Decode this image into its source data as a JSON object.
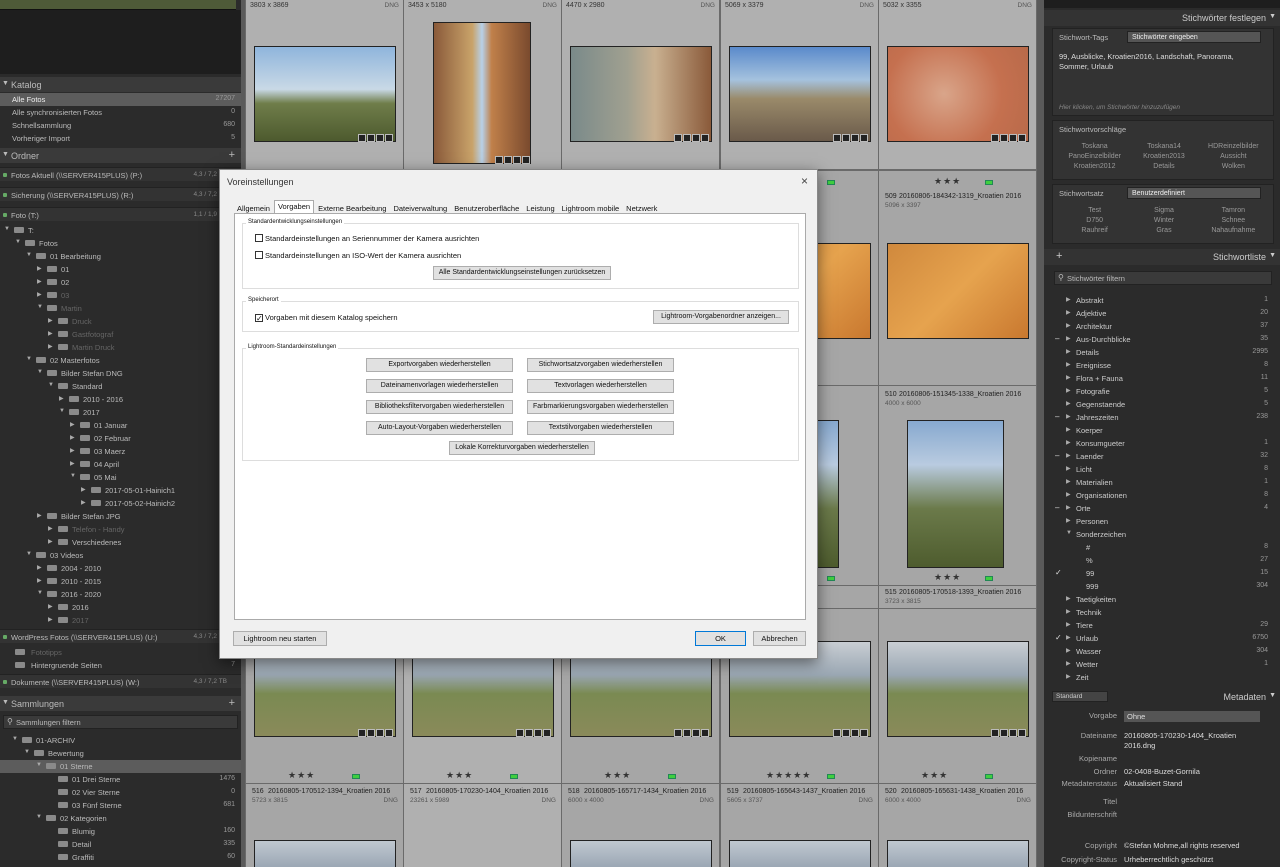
{
  "left": {
    "catalog": {
      "header": "Katalog",
      "items": [
        {
          "label": "Alle Fotos",
          "count": "27207",
          "selected": true
        },
        {
          "label": "Alle synchronisierten Fotos",
          "count": "0"
        },
        {
          "label": "Schnellsammlung",
          "count": "680"
        },
        {
          "label": "Vorheriger Import",
          "count": "5"
        }
      ]
    },
    "folders": {
      "header": "Ordner",
      "volumes": [
        {
          "label": "Fotos Aktuell (\\\\SERVER415PLUS) (P:)",
          "size": "4,3 / 7,2 TB"
        },
        {
          "label": "Sicherung (\\\\SERVER415PLUS) (R:)",
          "size": "4,3 / 7,2 TB"
        },
        {
          "label": "Foto (T:)",
          "size": "1,1 / 1,9 TB"
        }
      ],
      "tree": [
        {
          "d": 0,
          "label": "T:",
          "open": true,
          "count": "2"
        },
        {
          "d": 1,
          "label": "Fotos",
          "open": true,
          "count": "2"
        },
        {
          "d": 2,
          "label": "01 Bearbeitung",
          "open": true,
          "count": "2"
        },
        {
          "d": 3,
          "label": "01"
        },
        {
          "d": 3,
          "label": "02"
        },
        {
          "d": 3,
          "label": "03",
          "dim": true
        },
        {
          "d": 3,
          "label": "Martin",
          "open": true,
          "dim": true
        },
        {
          "d": 4,
          "label": "Druck",
          "dim": true
        },
        {
          "d": 4,
          "label": "Gastfotograf",
          "dim": true
        },
        {
          "d": 4,
          "label": "Martin Druck",
          "dim": true
        },
        {
          "d": 2,
          "label": "02 Masterfotos",
          "open": true,
          "count": "2"
        },
        {
          "d": 3,
          "label": "Bilder Stefan DNG",
          "open": true,
          "count": "2"
        },
        {
          "d": 4,
          "label": "Standard",
          "open": true,
          "count": "2"
        },
        {
          "d": 5,
          "label": "2010 - 2016",
          "count": "2"
        },
        {
          "d": 5,
          "label": "2017",
          "open": true
        },
        {
          "d": 6,
          "label": "01 Januar"
        },
        {
          "d": 6,
          "label": "02 Februar"
        },
        {
          "d": 6,
          "label": "03 Maerz"
        },
        {
          "d": 6,
          "label": "04 April"
        },
        {
          "d": 6,
          "label": "05 Mai",
          "open": true
        },
        {
          "d": 7,
          "label": "2017-05-01-Hainich1"
        },
        {
          "d": 7,
          "label": "2017-05-02-Hainich2"
        },
        {
          "d": 3,
          "label": "Bilder Stefan JPG",
          "count": "2"
        },
        {
          "d": 4,
          "label": "Telefon - Handy",
          "dim": true
        },
        {
          "d": 4,
          "label": "Verschiedenes"
        },
        {
          "d": 2,
          "label": "03 Videos",
          "open": true,
          "count": "2"
        },
        {
          "d": 3,
          "label": "2004 - 2010",
          "count": "2"
        },
        {
          "d": 3,
          "label": "2010 - 2015",
          "count": "2"
        },
        {
          "d": 3,
          "label": "2016 - 2020",
          "open": true,
          "count": "2"
        },
        {
          "d": 4,
          "label": "2016",
          "count": "2"
        },
        {
          "d": 4,
          "label": "2017",
          "dim": true
        }
      ],
      "volume4": {
        "label": "WordPress Fotos (\\\\SERVER415PLUS) (U:)",
        "size": "4,3 / 7,2 TB"
      },
      "extra": [
        {
          "label": "Fototipps",
          "dim": true
        },
        {
          "label": "Hintergruende Seiten",
          "count": "7"
        }
      ],
      "volume5": {
        "label": "Dokumente (\\\\SERVER415PLUS) (W:)",
        "size": "4,3 / 7,2 TB"
      }
    },
    "collections": {
      "header": "Sammlungen",
      "filter": "Sammlungen filtern",
      "tree": [
        {
          "d": 0,
          "label": "01-ARCHIV"
        },
        {
          "d": 1,
          "label": "Bewertung"
        },
        {
          "d": 2,
          "label": "01 Sterne",
          "selected": true
        },
        {
          "d": 3,
          "label": "01 Drei Sterne",
          "count": "1476"
        },
        {
          "d": 3,
          "label": "02 Vier Sterne",
          "count": "0"
        },
        {
          "d": 3,
          "label": "03 Fünf Sterne",
          "count": "681"
        },
        {
          "d": 2,
          "label": "02 Kategorien"
        },
        {
          "d": 3,
          "label": "Blumig",
          "count": "160"
        },
        {
          "d": 3,
          "label": "Detail",
          "count": "335"
        },
        {
          "d": 3,
          "label": "Graffiti",
          "count": "60"
        }
      ]
    }
  },
  "grid": {
    "row0": [
      {
        "dims": "3803 x 3869",
        "ext": "DNG"
      },
      {
        "dims": "3453 x 5180",
        "ext": "DNG"
      },
      {
        "dims": "4470 x 2980",
        "ext": "DNG"
      },
      {
        "dims": "5069 x 3379",
        "ext": "DNG"
      },
      {
        "dims": "5032 x 3355",
        "ext": "DNG"
      }
    ],
    "row1_right": [
      {
        "name": "8_Kroatien 2016",
        "dims": "5096 x 3397"
      },
      {
        "num": "509",
        "name": "20160806-184342-1319_Kroatien 2016",
        "dims": "5096 x 3397"
      }
    ],
    "row2_right": [
      {
        "name": "7_Kroatien 2016",
        "dims": "4000 x 6000"
      },
      {
        "num": "510",
        "name": "20160806-151345-1338_Kroatien 2016",
        "dims": "4000 x 6000"
      }
    ],
    "row3_right": [
      {
        "name": "8_Kroatien 2016",
        "dims": "3723 x 3815"
      },
      {
        "num": "515",
        "name": "20160805-170518-1393_Kroatien 2016",
        "dims": "3723 x 3815"
      }
    ],
    "row4": [
      {
        "num": "516",
        "name": "20160805-170512-1394_Kroatien 2016",
        "dims": "5723 x 3815",
        "stars": "★★★"
      },
      {
        "num": "517",
        "name": "20160805-170230-1404_Kroatien 2016",
        "dims": "23261 x 5989",
        "stars": "★★★"
      },
      {
        "num": "518",
        "name": "20160805-165717-1434_Kroatien 2016",
        "dims": "6000 x 4000",
        "stars": "★★★"
      },
      {
        "num": "519",
        "name": "20160805-165643-1437_Kroatien 2016",
        "dims": "5605 x 3737",
        "stars": "★★★★★"
      },
      {
        "num": "520",
        "name": "20160805-165631-1438_Kroatien 2016",
        "dims": "6000 x 4000",
        "stars": "★★★"
      }
    ],
    "ext": "DNG",
    "stars3": "★★★"
  },
  "right": {
    "top_label": "Stichwörter festlegen",
    "kw_tags_label": "Stichwort-Tags",
    "kw_tags_select": "Stichwörter eingeben",
    "kw_text": "99, Ausblicke, Kroatien2016, Landschaft, Panorama, Sommer, Urlaub",
    "kw_hint": "Hier klicken, um Stichwörter hinzuzufügen",
    "suggest_label": "Stichwortvorschläge",
    "suggestions": [
      "Toskana",
      "Toskana14",
      "HDReinzelbilder",
      "PanoEinzelbilder",
      "Kroatien2013",
      "Aussicht",
      "Kroatien2012",
      "Details",
      "Wolken"
    ],
    "set_label": "Stichwortsatz",
    "set_select": "Benutzerdefiniert",
    "set_items": [
      "Test",
      "Sigma",
      "Tamron",
      "D750",
      "Winter",
      "Schnee",
      "Rauhreif",
      "Gras",
      "Nahaufnahme"
    ],
    "list_header": "Stichwortliste",
    "filter": "Stichwörter filtern",
    "keywords": [
      {
        "label": "Abstrakt",
        "count": "1"
      },
      {
        "label": "Adjektive",
        "count": "20"
      },
      {
        "label": "Architektur",
        "count": "37"
      },
      {
        "label": "Aus-Durchblicke",
        "count": "35",
        "mark": "–"
      },
      {
        "label": "Details",
        "count": "2995"
      },
      {
        "label": "Ereignisse",
        "count": "8"
      },
      {
        "label": "Flora + Fauna",
        "count": "11"
      },
      {
        "label": "Fotografie",
        "count": "5"
      },
      {
        "label": "Gegenstaende",
        "count": "5"
      },
      {
        "label": "Jahreszeiten",
        "count": "238",
        "mark": "–"
      },
      {
        "label": "Koerper",
        "count": ""
      },
      {
        "label": "Konsumgueter",
        "count": "1"
      },
      {
        "label": "Laender",
        "count": "32",
        "mark": "–"
      },
      {
        "label": "Licht",
        "count": "8"
      },
      {
        "label": "Materialien",
        "count": "1"
      },
      {
        "label": "Organisationen",
        "count": "8"
      },
      {
        "label": "Orte",
        "count": "4",
        "mark": "–"
      },
      {
        "label": "Personen",
        "count": ""
      },
      {
        "label": "Sonderzeichen",
        "count": "",
        "open": true
      },
      {
        "label": "#",
        "count": "8",
        "sub": true
      },
      {
        "label": "%",
        "count": "27",
        "sub": true
      },
      {
        "label": "99",
        "count": "15",
        "sub": true,
        "check": true
      },
      {
        "label": "999",
        "count": "304",
        "sub": true
      },
      {
        "label": "Taetigkeiten",
        "count": ""
      },
      {
        "label": "Technik",
        "count": ""
      },
      {
        "label": "Tiere",
        "count": "29"
      },
      {
        "label": "Urlaub",
        "count": "6750",
        "check": true
      },
      {
        "label": "Wasser",
        "count": "304"
      },
      {
        "label": "Wetter",
        "count": "1"
      },
      {
        "label": "Zeit",
        "count": ""
      }
    ],
    "meta_header": "Metadaten",
    "meta_preset_select": "Standard",
    "meta_rows": [
      {
        "label": "Vorgabe",
        "value": "Ohne"
      },
      {
        "label": "Dateiname",
        "value": "20160805-170230-1404_Kroatien 2016.dng"
      },
      {
        "label": "Kopiename",
        "value": ""
      },
      {
        "label": "Ordner",
        "value": "02-0408-Buzet-Gornila"
      },
      {
        "label": "Metadatenstatus",
        "value": "Aktualisiert Stand"
      },
      {
        "label": "Titel",
        "value": ""
      },
      {
        "label": "Bildunterschrift",
        "value": ""
      },
      {
        "label": "Copyright",
        "value": "©Stefan Mohme,all rights reserved"
      },
      {
        "label": "Copyright-Status",
        "value": "Urheberrechtlich geschützt"
      }
    ]
  },
  "dialog": {
    "title": "Voreinstellungen",
    "close": "×",
    "tabs": [
      "Allgemein",
      "Vorgaben",
      "Externe Bearbeitung",
      "Dateiverwaltung",
      "Benutzeroberfläche",
      "Leistung",
      "Lightroom mobile",
      "Netzwerk"
    ],
    "active_tab": 1,
    "g1_label": "Standardentwicklungseinstellungen",
    "g1_cb1": "Standardeinstellungen an Seriennummer der Kamera ausrichten",
    "g1_cb2": "Standardeinstellungen an ISO-Wert der Kamera ausrichten",
    "g1_btn": "Alle Standardentwicklungseinstellungen zurücksetzen",
    "g2_label": "Speicherort",
    "g2_cb": "Vorgaben mit diesem Katalog speichern",
    "g2_btn": "Lightroom-Vorgabenordner anzeigen...",
    "g3_label": "Lightroom-Standardeinstellungen",
    "g3_buttons": [
      "Exportvorgaben wiederherstellen",
      "Stichwortsatzvorgaben wiederherstellen",
      "Dateinamenvorlagen wiederherstellen",
      "Textvorlagen wiederherstellen",
      "Bibliotheksfiltervorgaben wiederherstellen",
      "Farbmarkierungsvorgaben wiederherstellen",
      "Auto-Layout-Vorgaben wiederherstellen",
      "Textstilvorgaben wiederherstellen"
    ],
    "g3_last": "Lokale Korrekturvorgaben wiederherstellen",
    "restart": "Lightroom neu starten",
    "ok": "OK",
    "cancel": "Abbrechen"
  }
}
